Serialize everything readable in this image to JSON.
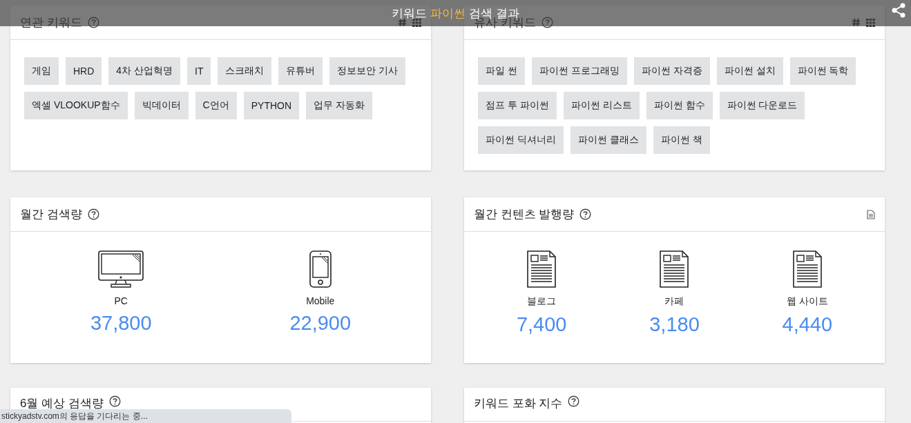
{
  "header": {
    "title_before": "키워드",
    "keyword": "파이썬",
    "title_after": "검색 결과"
  },
  "cards": [
    {
      "kind": "tags",
      "title": "연관 키워드",
      "tools": true,
      "tags": [
        "게임",
        "HRD",
        "4차 산업혁명",
        "IT",
        "스크래치",
        "유튜버",
        "정보보안 기사",
        "엑셀 VLOOKUP함수",
        "빅데이터",
        "C언어",
        "PYTHON",
        "업무 자동화"
      ]
    },
    {
      "kind": "tags",
      "title": "유사 키워드",
      "tools": true,
      "tags": [
        "파일 썬",
        "파이썬 프로그래밍",
        "파이썬 자격증",
        "파이썬 설치",
        "파이썬 독학",
        "점프 투 파이썬",
        "파이썬 리스트",
        "파이썬 함수",
        "파이썬 다운로드",
        "파이썬 딕셔너리",
        "파이썬 클래스",
        "파이썬 책"
      ]
    },
    {
      "kind": "stats",
      "title": "월간 검색량",
      "tools": false,
      "items": [
        {
          "kind": "pc",
          "label": "PC",
          "value": "37,800"
        },
        {
          "kind": "mobile",
          "label": "Mobile",
          "value": "22,900"
        }
      ]
    },
    {
      "kind": "stats",
      "title": "월간 컨텐츠 발행량",
      "tools": false,
      "report": true,
      "items": [
        {
          "kind": "document",
          "label": "블로그",
          "value": "7,400"
        },
        {
          "kind": "document",
          "label": "카페",
          "value": "3,180"
        },
        {
          "kind": "document",
          "label": "웹 사이트",
          "value": "4,440"
        }
      ]
    },
    {
      "kind": "empty",
      "title": "6월 예상 검색량",
      "tools": false
    },
    {
      "kind": "empty",
      "title": "키워드 포화 지수",
      "tools": false
    }
  ],
  "status": "stickyadstv.com의 응답을 기다리는 중..."
}
